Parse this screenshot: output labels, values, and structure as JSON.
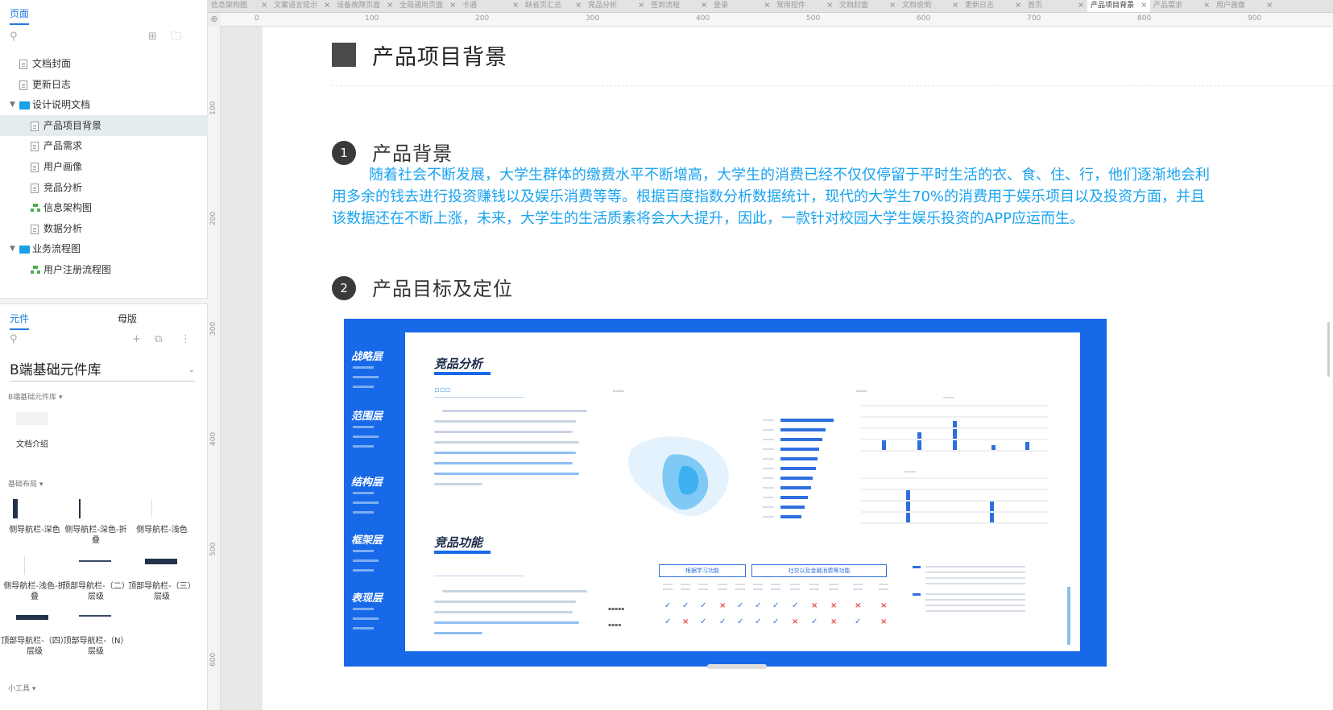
{
  "left_panel": {
    "pages_tab": "页面",
    "tree": [
      {
        "label": "文档封面",
        "icon": "page",
        "level": 1,
        "selected": false
      },
      {
        "label": "更新日志",
        "icon": "page",
        "level": 1,
        "selected": false
      },
      {
        "label": "设计说明文档",
        "icon": "folder",
        "level": 0,
        "selected": false,
        "expanded": true
      },
      {
        "label": "产品项目背景",
        "icon": "page",
        "level": 2,
        "selected": true
      },
      {
        "label": "产品需求",
        "icon": "page",
        "level": 2,
        "selected": false
      },
      {
        "label": "用户画像",
        "icon": "page",
        "level": 2,
        "selected": false
      },
      {
        "label": "竞品分析",
        "icon": "page",
        "level": 2,
        "selected": false
      },
      {
        "label": "信息架构图",
        "icon": "flowchart",
        "level": 2,
        "selected": false
      },
      {
        "label": "数据分析",
        "icon": "page",
        "level": 2,
        "selected": false
      },
      {
        "label": "业务流程图",
        "icon": "folder",
        "level": 0,
        "selected": false,
        "expanded": true
      },
      {
        "label": "用户注册流程图",
        "icon": "flowchart",
        "level": 2,
        "selected": false
      }
    ],
    "comp_tabs": {
      "widgets": "元件",
      "masters": "母版"
    },
    "library_name": "B端基础元件库",
    "sections": {
      "library": "B端基础元件库 ▾",
      "layout": "基础布局 ▾",
      "tools": "小工具 ▾"
    },
    "doc_intro": "文档介绍",
    "widgets": [
      {
        "label": "侧导航栏-深色"
      },
      {
        "label": "侧导航栏-深色-折叠"
      },
      {
        "label": "侧导航栏-浅色"
      },
      {
        "label": "侧导航栏-浅色-折叠"
      },
      {
        "label": "顶部导航栏-（二）层级"
      },
      {
        "label": "顶部导航栏-（三）层级"
      },
      {
        "label": "顶部导航栏-（四）层级"
      },
      {
        "label": "顶部导航栏-（N）层级"
      }
    ]
  },
  "tabs": [
    "信息架构图",
    "文案语言提示",
    "设备故障页面",
    "全局通用页面",
    "卡通",
    "缺省页汇总",
    "竞品分析",
    "签到流程",
    "登录",
    "常用控件",
    "文档封面",
    "文档说明",
    "更新日志",
    "首页",
    "产品项目背景",
    "产品需求",
    "用户画像"
  ],
  "active_tab": "产品项目背景",
  "ruler": {
    "h": [
      "0",
      "100",
      "200",
      "300",
      "400",
      "500",
      "600",
      "700",
      "800",
      "900"
    ],
    "v": [
      "100",
      "200",
      "300",
      "400",
      "500",
      "600"
    ]
  },
  "content": {
    "page_title": "产品项目背景",
    "sections": [
      {
        "number": "1",
        "title": "产品背景"
      },
      {
        "number": "2",
        "title": "产品目标及定位"
      }
    ],
    "background_text": "随着社会不断发展，大学生群体的缴费水平不断增高，大学生的消费已经不仅仅停留于平时生活的衣、食、住、行，他们逐渐地会利用多余的钱去进行投资赚钱以及娱乐消费等等。根据百度指数分析数据统计，现代的大学生70%的消费用于娱乐项目以及投资方面，并且该数据还在不断上涨，未来，大学生的生活质素将会大大提升，因此，一款针对校园大学生娱乐投资的APP应运而生。",
    "embedded": {
      "side_layers": [
        "战略层",
        "范围层",
        "结构层",
        "框架层",
        "表现层"
      ],
      "card_titles": [
        "竞品分析",
        "竞品功能"
      ],
      "feature_boxes": [
        "根据学习功能",
        "社交以及金融消费等功能"
      ],
      "colors": {
        "blue": "#1769e8",
        "bar": "#2f6fe0",
        "text_blue": "#1aa3f0"
      }
    }
  }
}
